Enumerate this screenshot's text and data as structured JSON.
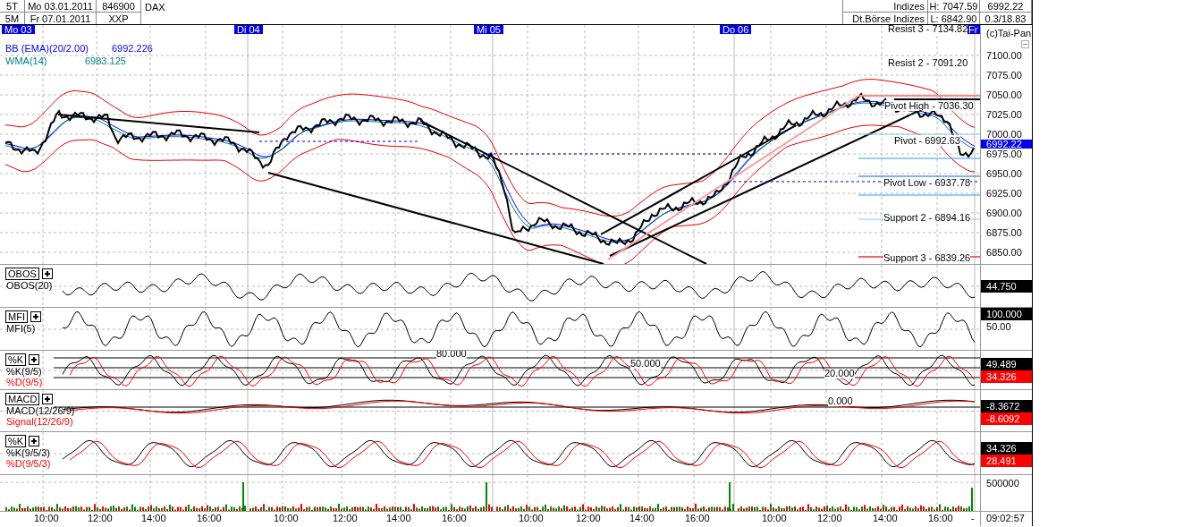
{
  "header": {
    "periods": [
      {
        "label": "5T",
        "date": "Mo 03.01.2011"
      },
      {
        "label": "5M",
        "date": "Fr 07.01.2011"
      }
    ],
    "code": "846900",
    "exchange": "XXP",
    "name": "DAX",
    "category": "Indizes",
    "market": "Dt.Börse Indizes",
    "high": "H: 7047.59",
    "low": "L: 6842.90",
    "last": "6992.22",
    "change": "0.3/18.83"
  },
  "day_markers": [
    "Mo 03",
    "Di 04",
    "Mi 05",
    "Do 06",
    "Fr"
  ],
  "main_panel": {
    "legends": [
      {
        "name": "BB (EMA)(20/2.00)",
        "value": "6992.226",
        "color": "#0000ff"
      },
      {
        "name": "WMA(14)",
        "value": "6983.125",
        "color": "#008080"
      }
    ],
    "pivot_labels": [
      "Resist 3 - 7134.82",
      "Resist 2 - 7091.20",
      "Pivot High - 7036.30",
      "Pivot - 6992.63",
      "Pivot Low - 6937.78",
      "Support 2 - 6894.16",
      "Support 3 - 6839.26"
    ],
    "copyright": "(c)Tai-Pan",
    "price_ticks": [
      "7100.00",
      "7075.00",
      "7050.00",
      "7025.00",
      "7000.00",
      "6975.00",
      "6950.00",
      "6925.00",
      "6900.00",
      "6875.00",
      "6850.00"
    ],
    "current_price": "6992.22"
  },
  "panels": [
    {
      "kind": "obos",
      "title": "OBOS",
      "legends": [
        {
          "text": "OBOS(20)",
          "kind": "main"
        }
      ],
      "readings": [
        {
          "text": "44.750",
          "color": "#000000"
        }
      ]
    },
    {
      "kind": "mfi",
      "title": "MFI",
      "legends": [
        {
          "text": "MFI(5)",
          "kind": "main"
        }
      ],
      "readings": [
        {
          "text": "100.000",
          "color": "#000000"
        }
      ],
      "ticks": [
        "50.00"
      ]
    },
    {
      "kind": "stoch",
      "title": "%K",
      "legends": [
        {
          "text": "%K(9/5)",
          "kind": "main"
        },
        {
          "text": "%D(9/5)",
          "kind": "signal"
        }
      ],
      "level_labels": [
        "80.000",
        "50.000",
        "20.000"
      ],
      "readings": [
        {
          "text": "49.489",
          "color": "#000000"
        },
        {
          "text": "34.326",
          "color": "#ff0000"
        }
      ]
    },
    {
      "kind": "macd",
      "title": "MACD",
      "legends": [
        {
          "text": "MACD(12/26/9)",
          "kind": "main"
        },
        {
          "text": "Signal(12/26/9)",
          "kind": "signal"
        }
      ],
      "level_labels": [
        "0.000"
      ],
      "readings": [
        {
          "text": "-8.3672",
          "color": "#000000"
        },
        {
          "text": "-8.6092",
          "color": "#ff0000"
        }
      ]
    },
    {
      "kind": "slowstoch",
      "title": "%K",
      "legends": [
        {
          "text": "%K(9/5/3)",
          "kind": "main"
        },
        {
          "text": "%D(9/5/3)",
          "kind": "signal"
        }
      ],
      "readings": [
        {
          "text": "34.326",
          "color": "#000000"
        },
        {
          "text": "28.491",
          "color": "#ff0000"
        }
      ]
    }
  ],
  "volume_panel": {
    "tick": "500000"
  },
  "time_axis": {
    "labels": [
      "10:00",
      "12:00",
      "14:00",
      "16:00",
      "10:00",
      "12:00",
      "14:00",
      "16:00",
      "10:00",
      "12:00",
      "14:00",
      "16:00",
      "10:00",
      "12:00",
      "14:00",
      "16:00"
    ],
    "marker": "-",
    "clock": "09:02:57"
  }
}
